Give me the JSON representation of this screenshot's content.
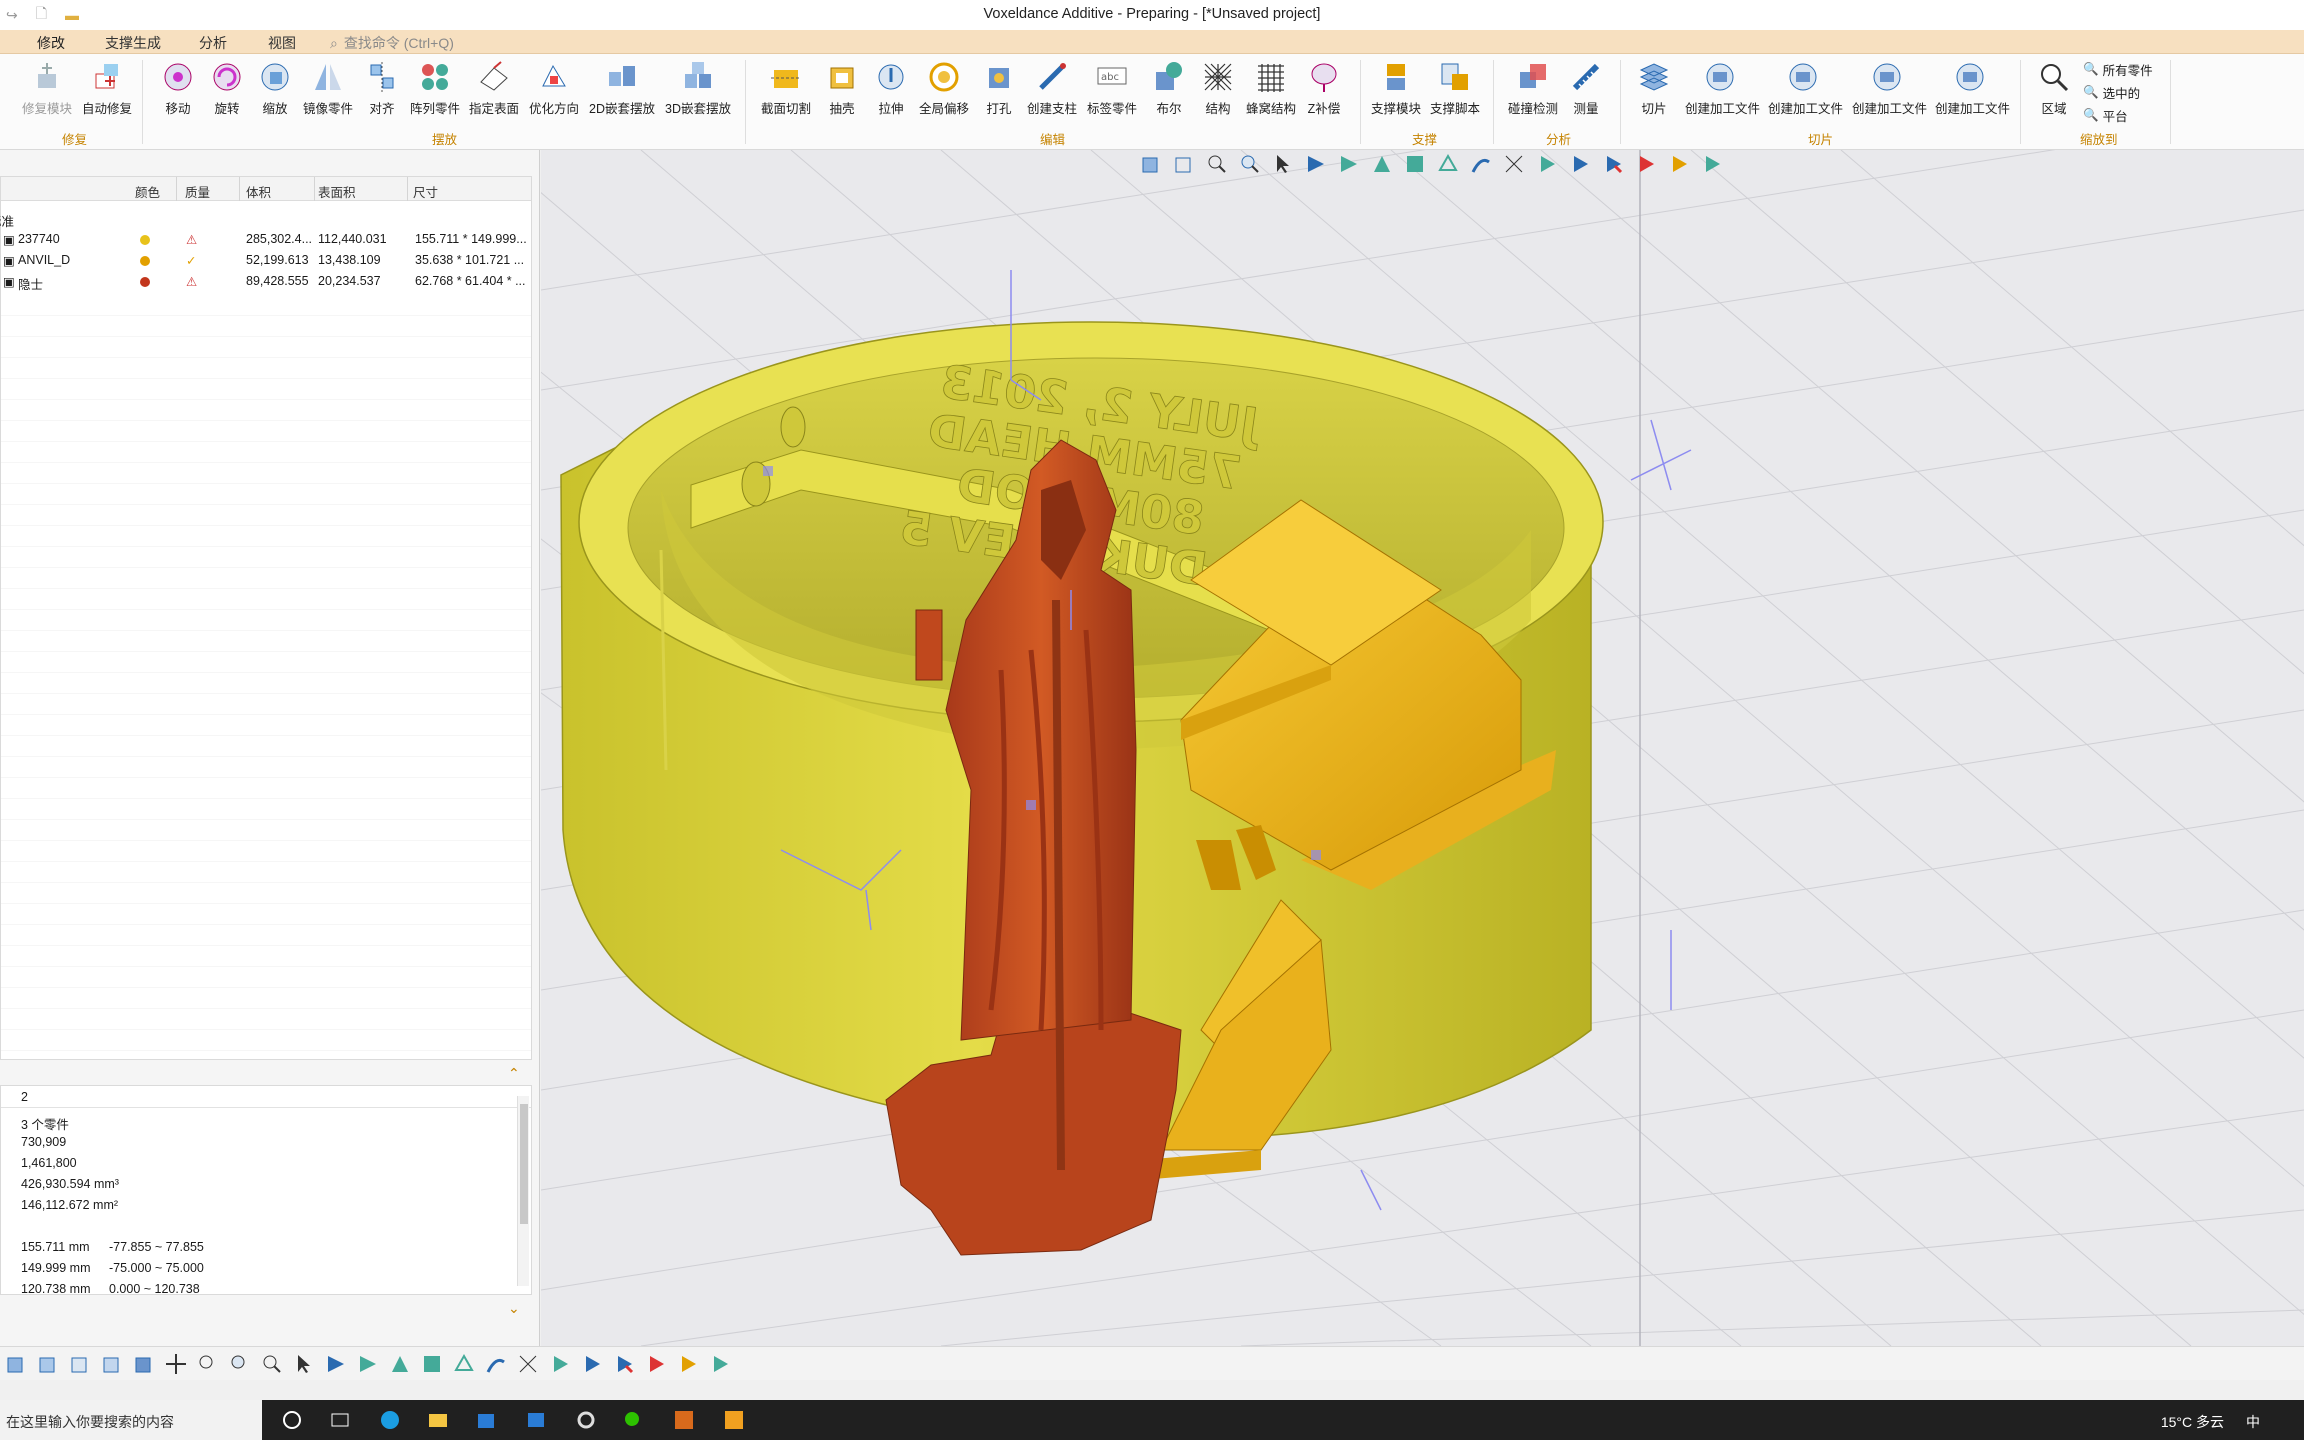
{
  "window": {
    "title": "Voxeldance Additive - Preparing - [*Unsaved project]"
  },
  "menu": {
    "tabs": [
      "修改",
      "支撑生成",
      "分析",
      "视图"
    ],
    "search_placeholder": "查找命令 (Ctrl+Q)"
  },
  "ribbon": {
    "buttons": [
      {
        "label": "修复模块"
      },
      {
        "label": "自动修复"
      },
      {
        "label": "移动"
      },
      {
        "label": "旋转"
      },
      {
        "label": "缩放"
      },
      {
        "label": "镜像零件"
      },
      {
        "label": "对齐"
      },
      {
        "label": "阵列零件"
      },
      {
        "label": "指定表面"
      },
      {
        "label": "优化方向"
      },
      {
        "label": "2D嵌套摆放"
      },
      {
        "label": "3D嵌套摆放"
      },
      {
        "label": "截面切割"
      },
      {
        "label": "抽壳"
      },
      {
        "label": "拉伸"
      },
      {
        "label": "全局偏移"
      },
      {
        "label": "打孔"
      },
      {
        "label": "创建支柱"
      },
      {
        "label": "标签零件"
      },
      {
        "label": "布尔"
      },
      {
        "label": "结构"
      },
      {
        "label": "蜂窝结构"
      },
      {
        "label": "Z补偿"
      },
      {
        "label": "支撑模块"
      },
      {
        "label": "支撑脚本"
      },
      {
        "label": "碰撞检测"
      },
      {
        "label": "测量"
      },
      {
        "label": "切片"
      },
      {
        "label": "创建加工文件"
      },
      {
        "label": "创建加工文件"
      },
      {
        "label": "创建加工文件"
      },
      {
        "label": "创建加工文件"
      },
      {
        "label": "区域"
      }
    ],
    "zoom_small": [
      "所有零件",
      "选中的",
      "平台"
    ],
    "groups": [
      "修复",
      "摆放",
      "编辑",
      "支撑",
      "分析",
      "切片",
      "缩放到"
    ]
  },
  "parts_panel": {
    "columns": [
      "颜色",
      "质量",
      "体积",
      "表面积",
      "尺寸"
    ],
    "group_label": "标准",
    "rows": [
      {
        "name": "237740",
        "color": "#e8c21a",
        "quality": "warning",
        "volume": "285,302.4...",
        "area": "112,440.031",
        "size": "155.711 * 149.999..."
      },
      {
        "name": "ANVIL_D",
        "color": "#e2a000",
        "quality": "ok",
        "volume": "52,199.613",
        "area": "13,438.109",
        "size": "35.638 * 101.721 ..."
      },
      {
        "name": "隐士",
        "color": "#c2361c",
        "quality": "warning",
        "volume": "89,428.555",
        "area": "20,234.537",
        "size": "62.768 * 61.404 * ..."
      }
    ]
  },
  "details_panel": {
    "header": "2",
    "lines": [
      {
        "a": "3 个零件",
        "b": ""
      },
      {
        "a": "730,909",
        "b": ""
      },
      {
        "a": "1,461,800",
        "b": ""
      },
      {
        "a": "426,930.594 mm³",
        "b": ""
      },
      {
        "a": "146,112.672 mm²",
        "b": ""
      },
      {
        "a": "",
        "b": ""
      },
      {
        "a": "155.711 mm",
        "b": "-77.855 ~ 77.855"
      },
      {
        "a": "149.999 mm",
        "b": "-75.000 ~ 75.000"
      },
      {
        "a": "120.738 mm",
        "b": "0.000 ~ 120.738"
      }
    ]
  },
  "viewport": {
    "engraving": [
      "JULY 2, 2013",
      "75MM HEAD",
      "80MM OD",
      "DUKE REV 5"
    ]
  },
  "taskbar": {
    "search_placeholder": "在这里输入你要搜索的内容",
    "weather": "15°C 多云",
    "ime": "中"
  },
  "colors": {
    "ring": "#e6e055",
    "anvil": "#f0b81c",
    "figure": "#cc4a1c",
    "accent": "#c58300"
  }
}
